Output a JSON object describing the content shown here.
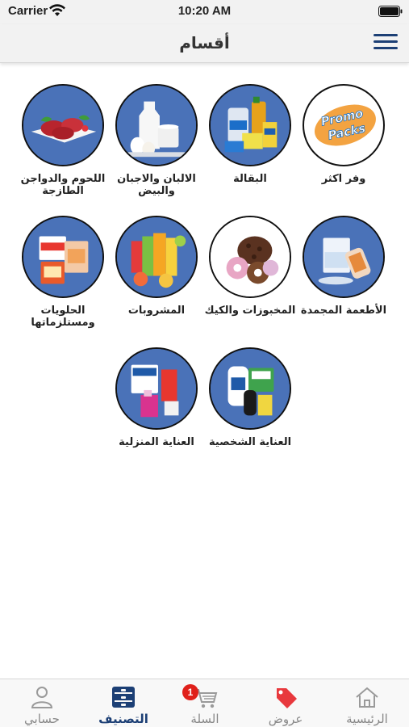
{
  "status_bar": {
    "carrier": "Carrier",
    "time": "10:20 AM"
  },
  "nav": {
    "title": "أقسام"
  },
  "categories": [
    {
      "label": "وفر اكثر",
      "image": "promo-packs",
      "badge_text": "Promo Packs"
    },
    {
      "label": "البقالة",
      "image": "grocery"
    },
    {
      "label": "الالبان والاجبان والبيض",
      "image": "dairy"
    },
    {
      "label": "اللحوم والدواجن الطازجة",
      "image": "meat"
    },
    {
      "label": "الأطعمة المجمدة",
      "image": "frozen"
    },
    {
      "label": "المخبوزات والكيك",
      "image": "bakery"
    },
    {
      "label": "المشروبات",
      "image": "drinks"
    },
    {
      "label": "الحلويات ومستلزماتها",
      "image": "sweets"
    },
    {
      "label": "العناية الشخصية",
      "image": "personal-care"
    },
    {
      "label": "العناية المنزلية",
      "image": "home-care"
    }
  ],
  "tabs": [
    {
      "label": "الرئيسية",
      "icon": "home-icon"
    },
    {
      "label": "عروض",
      "icon": "tag-icon"
    },
    {
      "label": "السلة",
      "icon": "cart-icon",
      "badge": "1"
    },
    {
      "label": "التصنيف",
      "icon": "category-icon",
      "active": true
    },
    {
      "label": "حسابي",
      "icon": "user-icon"
    }
  ],
  "colors": {
    "accent": "#1c3f75",
    "badge": "#e0211b",
    "offer": "#e8383d",
    "circle_bg": "#4a72b8"
  }
}
